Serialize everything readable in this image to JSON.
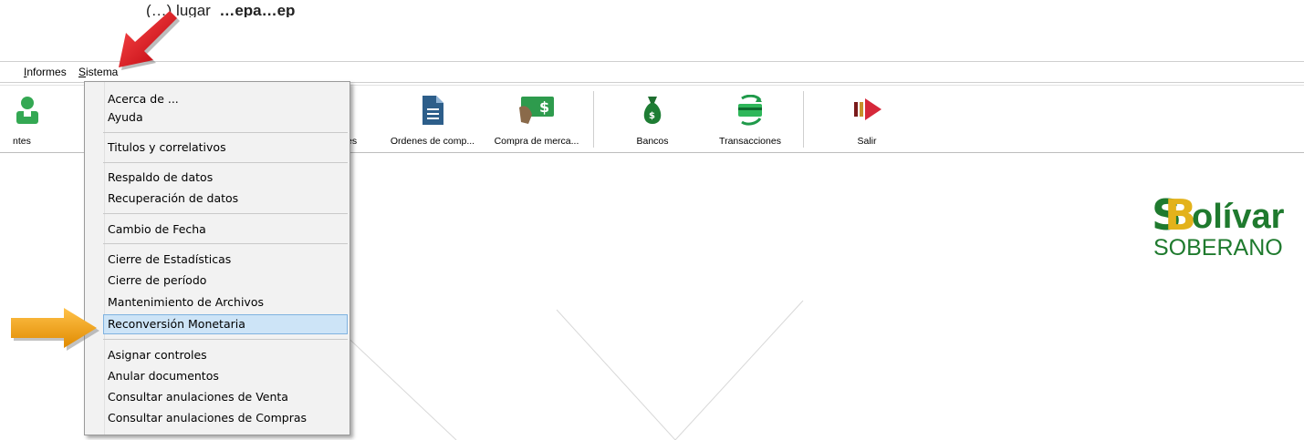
{
  "document_text": {
    "prefix": "(…) lugar",
    "bold": "…epa…ep"
  },
  "menubar": {
    "items": [
      {
        "label": "Informes"
      },
      {
        "label": "Sistema"
      }
    ]
  },
  "toolbar": {
    "items": [
      {
        "label": "ntes",
        "icon": "person-icon"
      },
      {
        "label": "es",
        "icon": "none"
      },
      {
        "label": "Ordenes de comp...",
        "icon": "document-icon"
      },
      {
        "label": "Compra de merca...",
        "icon": "money-hand-icon"
      },
      {
        "label": "Bancos",
        "icon": "money-bag-icon"
      },
      {
        "label": "Transacciones",
        "icon": "card-exchange-icon"
      },
      {
        "label": "Salir",
        "icon": "exit-arrow-icon"
      }
    ]
  },
  "sistema_menu": {
    "items": [
      {
        "label": "Acerca de ..."
      },
      {
        "label": "Ayuda"
      },
      {
        "label": "Titulos y correlativos"
      },
      {
        "label": "Respaldo de datos"
      },
      {
        "label": "Recuperación de datos"
      },
      {
        "label": "Cambio de Fecha"
      },
      {
        "label": "Cierre de Estadísticas"
      },
      {
        "label": "Cierre de período"
      },
      {
        "label": "Mantenimiento de Archivos"
      },
      {
        "label": "Reconversión Monetaria",
        "highlighted": true
      },
      {
        "label": "Asignar controles"
      },
      {
        "label": "Anular documentos"
      },
      {
        "label": "Consultar anulaciones de Venta"
      },
      {
        "label": "Consultar anulaciones de Compras"
      }
    ]
  },
  "logo": {
    "line1": "olívar",
    "line2": "SOBERANO",
    "green": "#1f7a2e"
  },
  "colors": {
    "highlight": "#cde4f7",
    "red_arrow": "#e0141a",
    "orange_arrow": "#f2a41c"
  }
}
